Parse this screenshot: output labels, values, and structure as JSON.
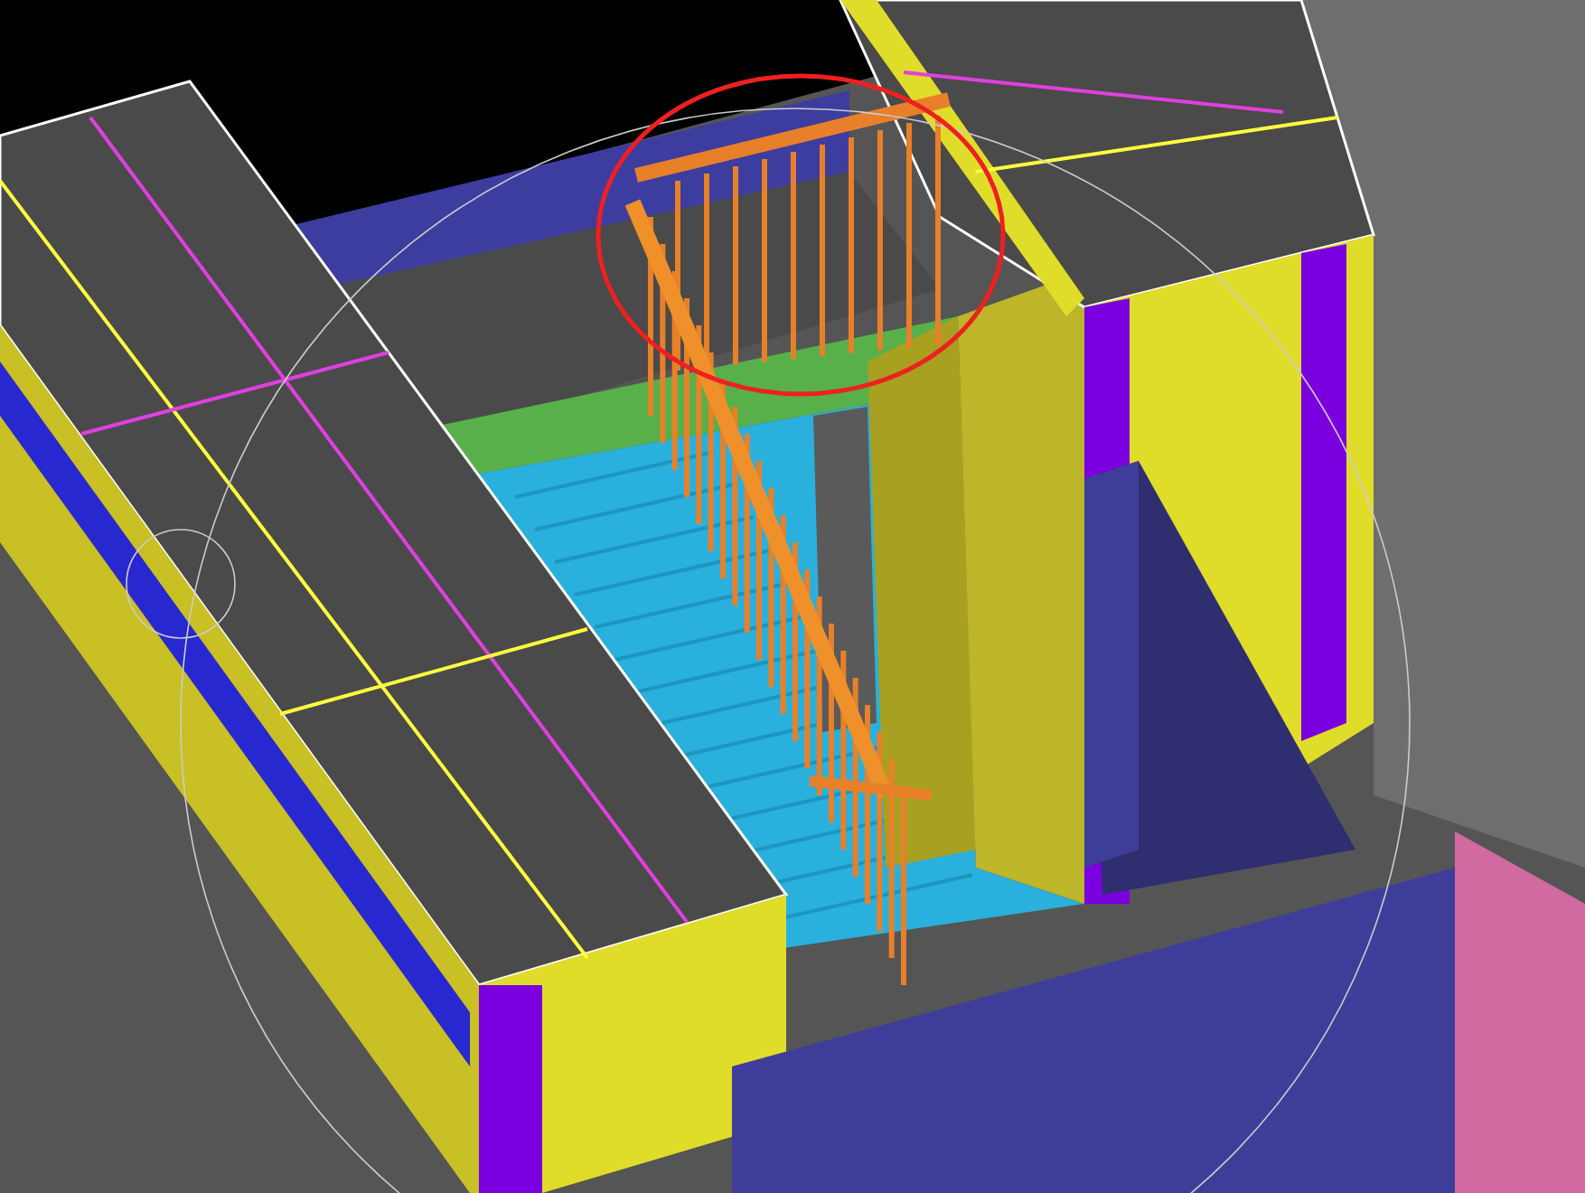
{
  "viewport": {
    "kind": "stair-model"
  }
}
